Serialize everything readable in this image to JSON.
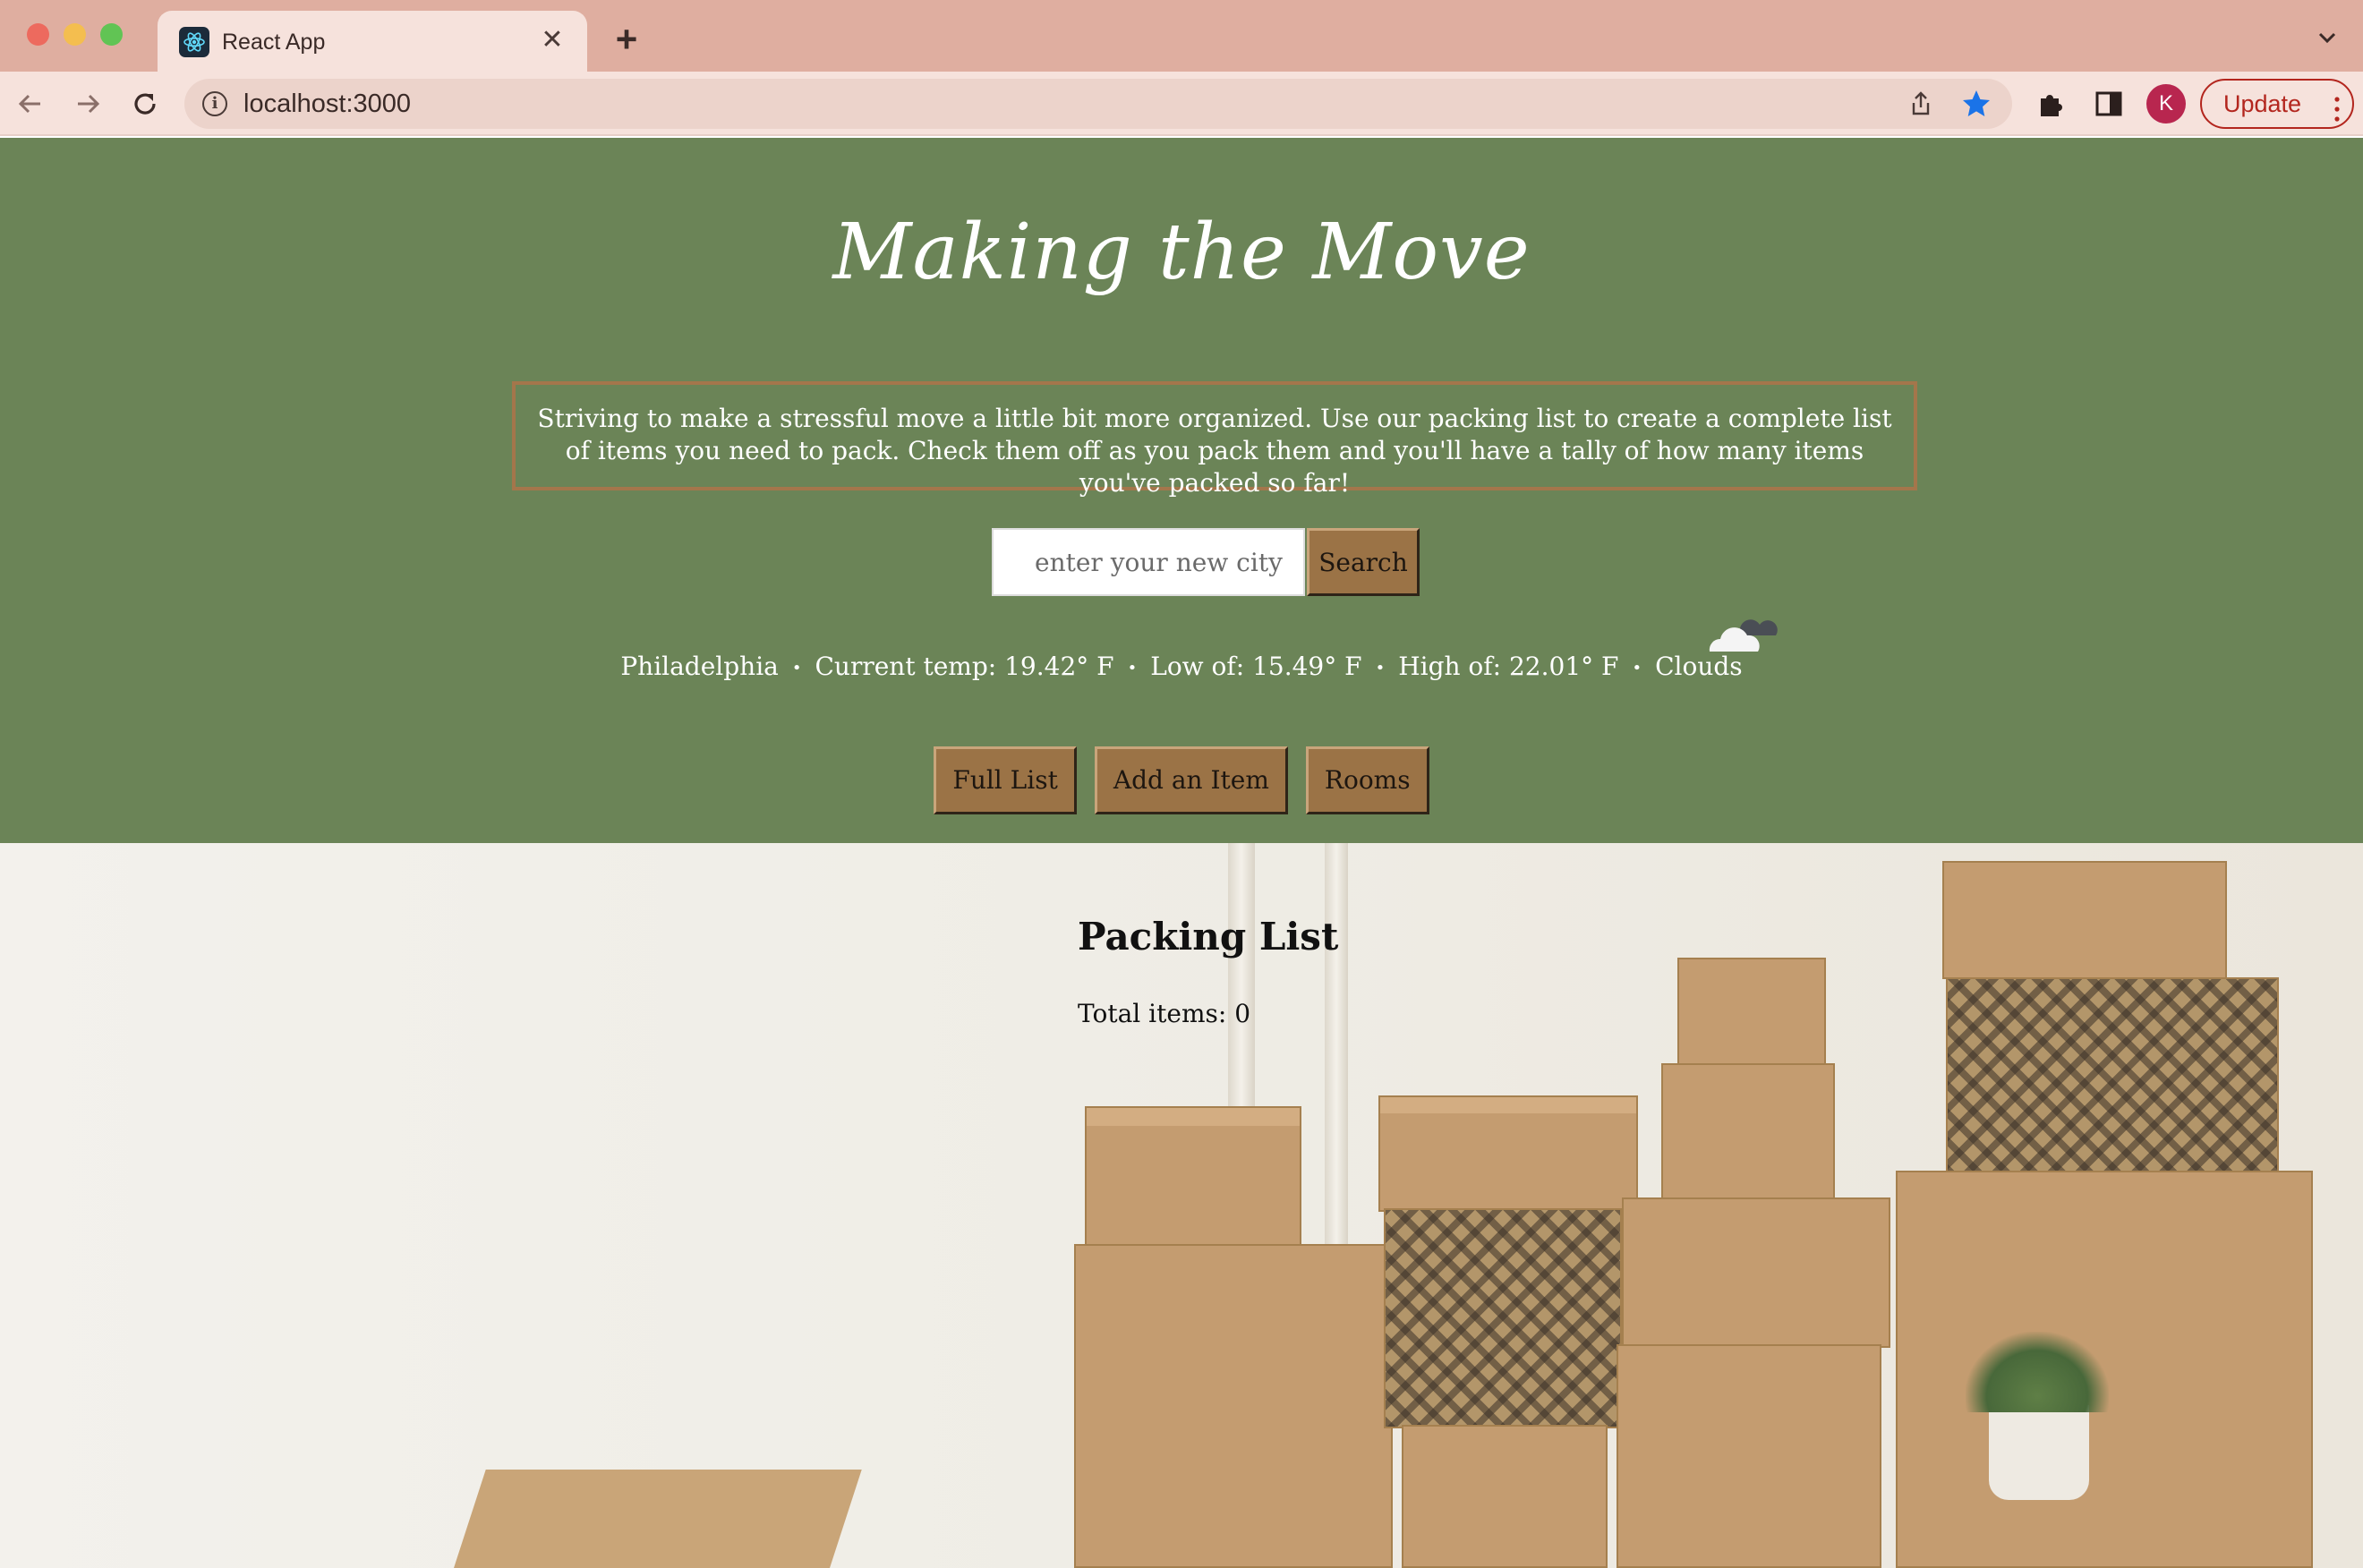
{
  "browser": {
    "tab_title": "React App",
    "url": "localhost:3000",
    "profile_initial": "K",
    "update_label": "Update"
  },
  "header": {
    "title": "Making the Move",
    "intro": "Striving to make a stressful move a little bit more organized. Use our packing list to create a complete list of items you need to pack. Check them off as you pack them and you'll have a tally of how many items you've packed so far!",
    "search": {
      "placeholder": "enter your new city",
      "button_label": "Search"
    },
    "weather": {
      "city": "Philadelphia",
      "current": "Current temp: 19.42° F",
      "low": "Low of: 15.49° F",
      "high": "High of: 22.01° F",
      "conditions": "Clouds",
      "icon": "clouds-icon"
    },
    "nav": [
      {
        "label": "Full List"
      },
      {
        "label": "Add an Item"
      },
      {
        "label": "Rooms"
      }
    ]
  },
  "main": {
    "list_title": "Packing List",
    "total_label": "Total items: 0"
  },
  "colors": {
    "header_bg": "#6b8457",
    "button_bg": "#9b7346",
    "intro_border": "#a4764b",
    "tabbar_bg": "#dfaea0"
  }
}
